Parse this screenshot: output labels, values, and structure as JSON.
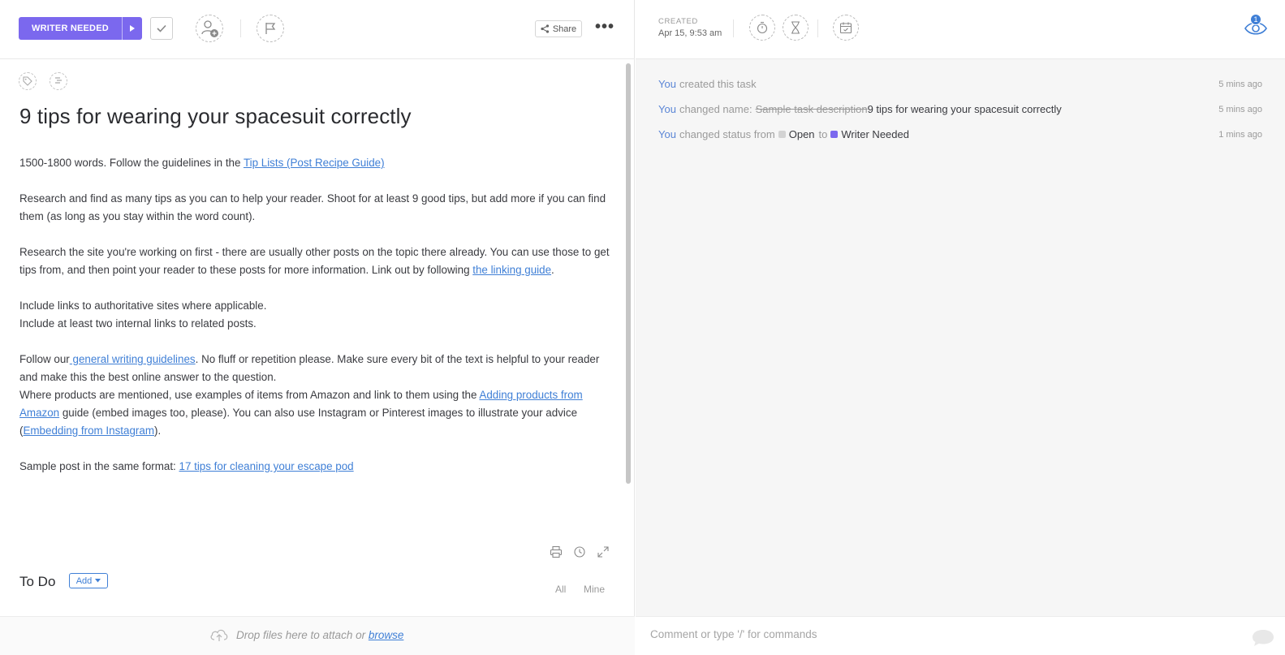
{
  "header": {
    "status_label": "WRITER NEEDED",
    "share_label": "Share",
    "more_label": "•••"
  },
  "task": {
    "title": "9 tips for wearing your spacesuit correctly",
    "paragraphs": {
      "p1_text": "1500-1800  words. Follow the guidelines in the ",
      "p1_link": "Tip Lists (Post Recipe Guide)",
      "p2_text": "Research and find as many tips as you can to help your reader. Shoot for at least 9 good tips, but add more if you can find them (as long as you stay within the word count).",
      "p3_text": "Research the site you're working on first - there are usually other posts on the topic there already. You can use those to get tips from, and then point your reader to these posts for more information. Link out by following ",
      "p3_link": "the linking guide",
      "p3_end": ".",
      "p4_line1": "Include links to authoritative sites where applicable.",
      "p4_line2": "Include at least two internal links to related posts.",
      "p5_text": "Follow our",
      "p5_link": " general writing guidelines",
      "p5_rest": ". No fluff or repetition please. Make sure every bit of the text is helpful to your reader and make this the best online answer to the question.",
      "p6_text": "Where products are mentioned, use examples of items from Amazon and link to them using the ",
      "p6_link": "Adding products from Amazon",
      "p6_rest": " guide (embed images too, please). You can also use Instagram or Pinterest images to illustrate your advice (",
      "p6_link2": "Embedding from Instagram",
      "p6_end": ").",
      "p7_text": "Sample post in the same format: ",
      "p7_link": "17 tips for cleaning your escape pod"
    }
  },
  "todo": {
    "title": "To Do",
    "add_label": "Add",
    "filter_all": "All",
    "filter_mine": "Mine"
  },
  "dropzone": {
    "text": "Drop files here to attach or ",
    "link": "browse"
  },
  "meta": {
    "created_label": "CREATED",
    "created_date": "Apr 15, 9:53 am",
    "watchers_count": "1"
  },
  "activity": [
    {
      "actor": "You",
      "text": "created this task",
      "time": "5 mins ago"
    },
    {
      "actor": "You",
      "text": "changed name:",
      "old": "Sample task description",
      "new": "9 tips for wearing your spacesuit correctly",
      "time": "5 mins ago"
    },
    {
      "actor": "You",
      "text": "changed status from",
      "from": "Open",
      "to_word": "to",
      "to": "Writer Needed",
      "time": "1 mins ago"
    }
  ],
  "comment": {
    "placeholder": "Comment or type '/' for commands"
  },
  "colors": {
    "accent": "#7b68ee",
    "link": "#3f7fd6",
    "open_status": "#d3d3d3",
    "writer_needed_status": "#7b68ee"
  }
}
